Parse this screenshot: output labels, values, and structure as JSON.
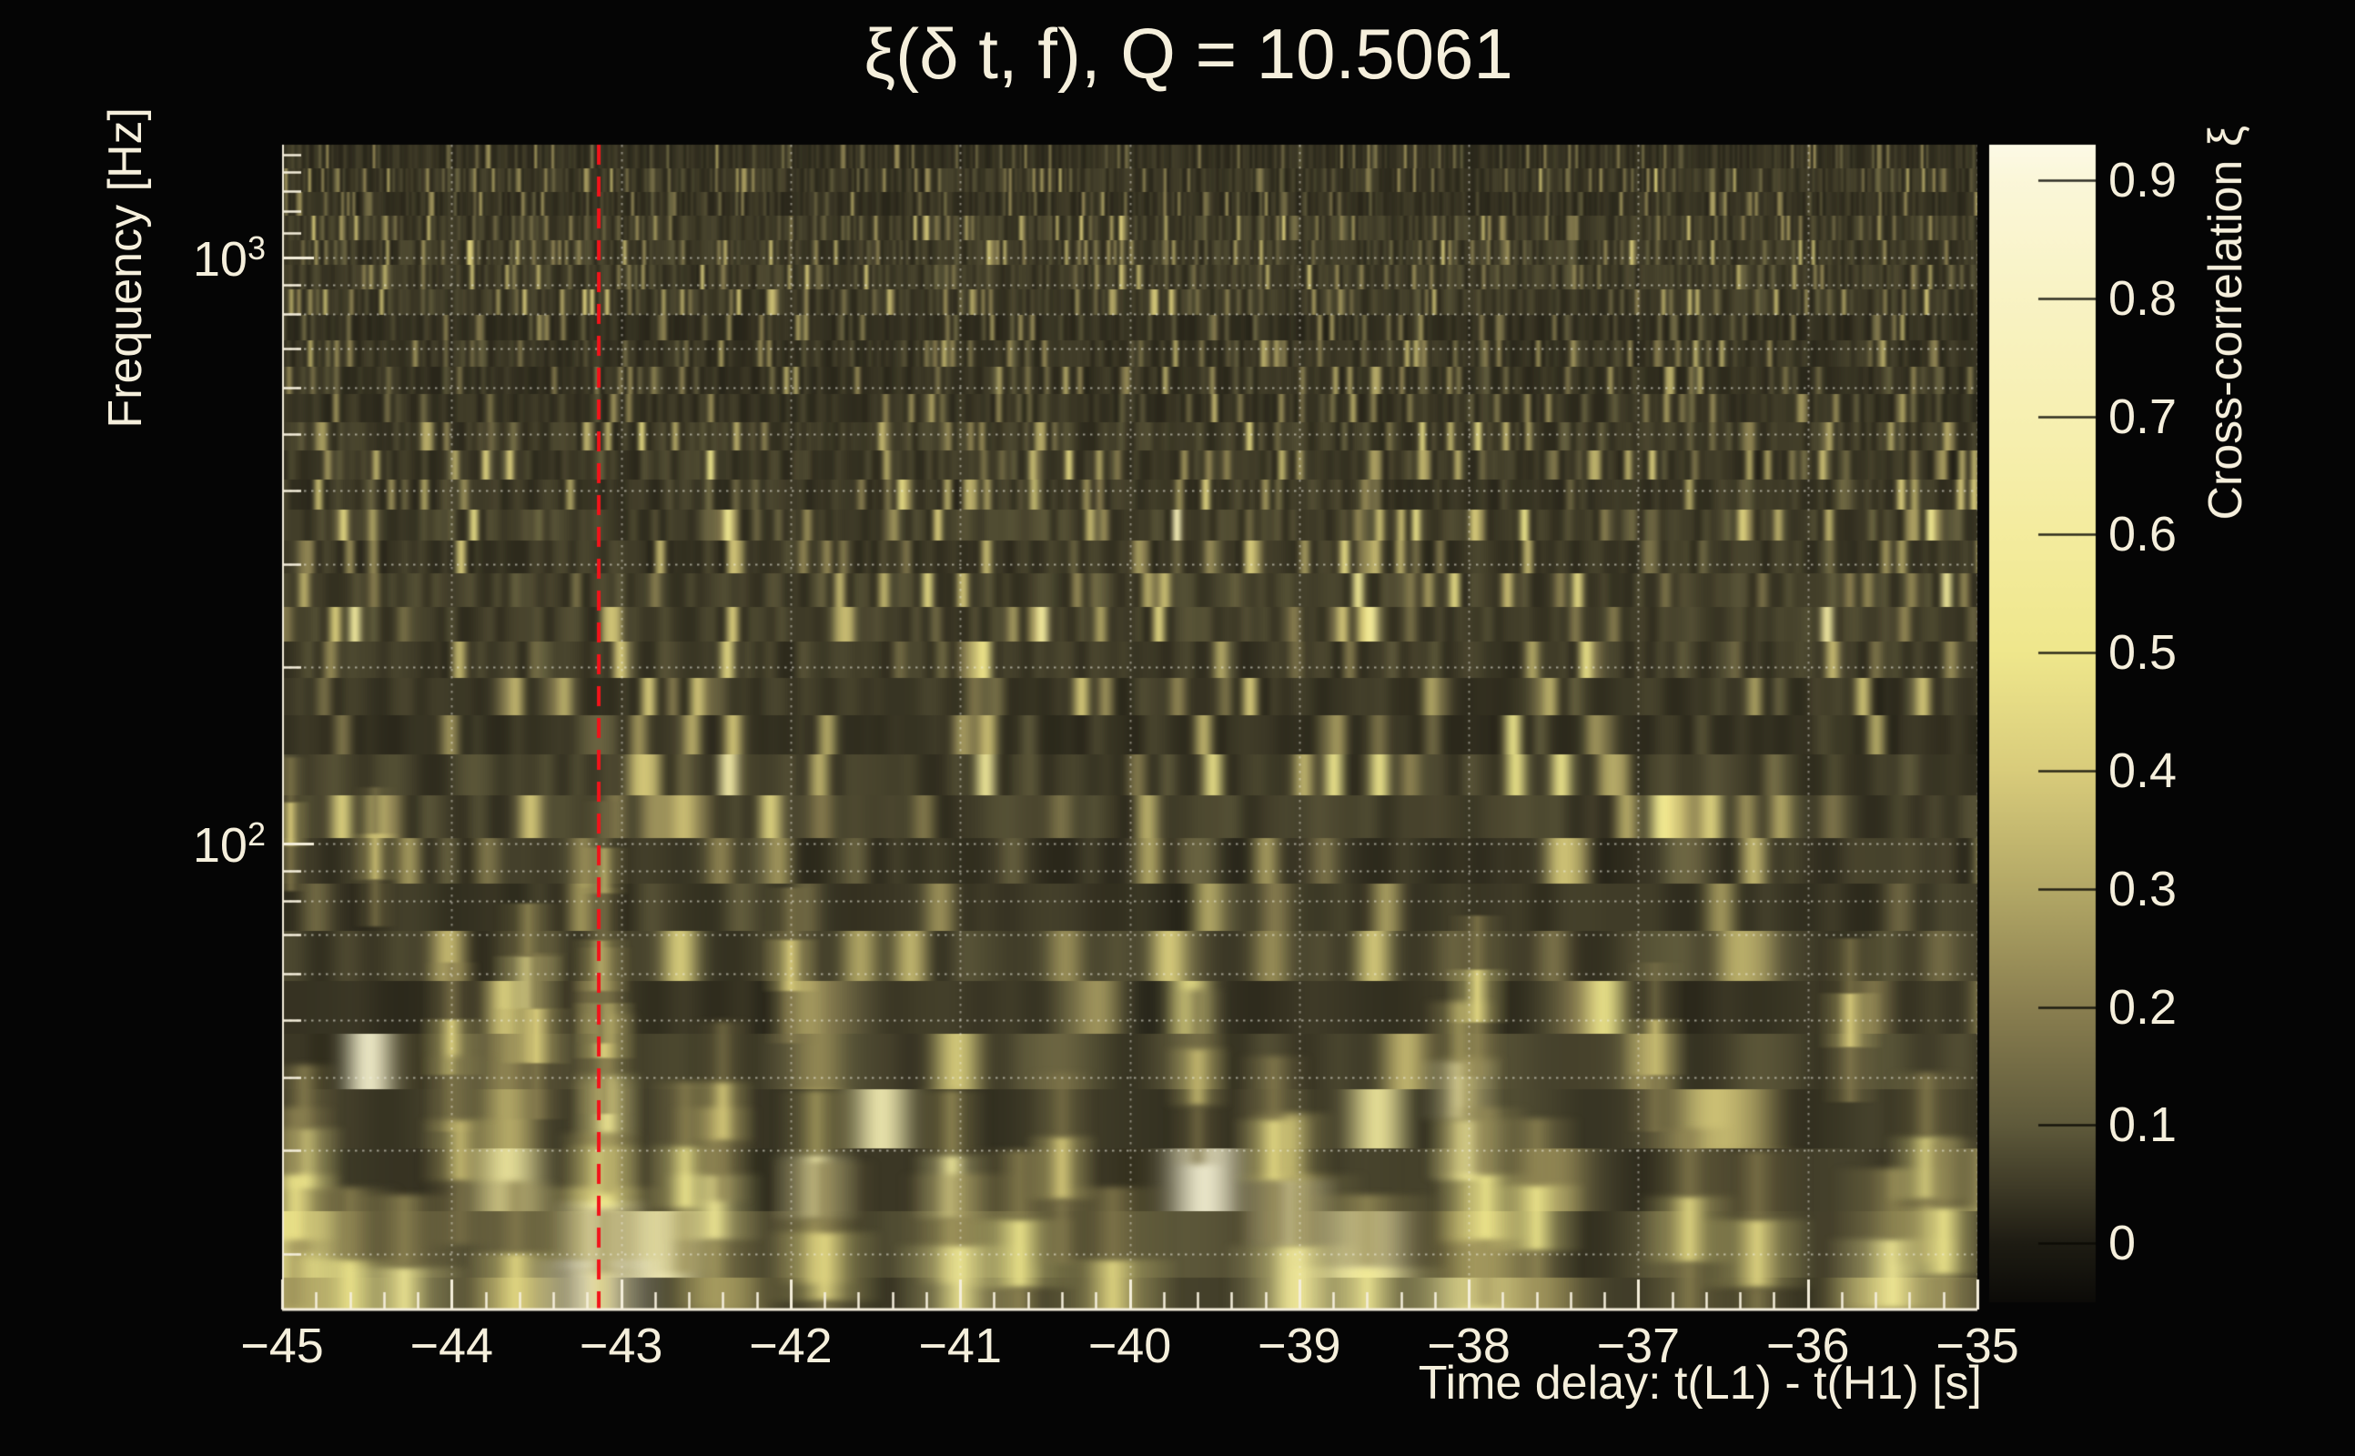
{
  "page": {
    "background_color": "#050505",
    "text_color": "#f5efdc"
  },
  "chart_data": {
    "type": "heatmap",
    "title": "ξ(δ t, f), Q = 10.5061",
    "xlabel": "Time delay: t(L1) - t(H1) [s]",
    "ylabel": "Frequency [Hz]",
    "zlabel": "Cross-correlation ξ",
    "x_range": [
      -45,
      -35
    ],
    "x_major_tick_values": [
      -45,
      -44,
      -43,
      -42,
      -41,
      -40,
      -39,
      -38,
      -37,
      -36,
      -35
    ],
    "x_tick_labels": [
      "−45",
      "−44",
      "−43",
      "−42",
      "−41",
      "−40",
      "−39",
      "−38",
      "−37",
      "−36",
      "−35"
    ],
    "x_minor_step": 0.2,
    "y_scale": "log",
    "y_range_hz": [
      16,
      1558
    ],
    "y_major_ticks": [
      {
        "value": 100,
        "base": "10",
        "exp": "2"
      },
      {
        "value": 1000,
        "base": "10",
        "exp": "3"
      }
    ],
    "y_gridline_frequencies": [
      20,
      30,
      40,
      50,
      60,
      70,
      80,
      90,
      100,
      200,
      300,
      400,
      500,
      600,
      700,
      800,
      900,
      1000
    ],
    "y_extra_minor_ticks": [
      1100,
      1200,
      1300,
      1400,
      1500
    ],
    "grid": {
      "style": "dotted",
      "color": "rgba(240,238,228,0.55)"
    },
    "marker_line": {
      "time_delay_s": -43.13,
      "color": "#f2131a",
      "style": "dashed"
    },
    "colorbar": {
      "value_top": 0.93,
      "value_bottom": -0.05,
      "tick_values": [
        0,
        0.1,
        0.2,
        0.3,
        0.4,
        0.5,
        0.6,
        0.7,
        0.8,
        0.9
      ],
      "tick_labels": [
        "0",
        "0.1",
        "0.2",
        "0.3",
        "0.4",
        "0.5",
        "0.6",
        "0.7",
        "0.8",
        "0.9"
      ],
      "colormap_stops": [
        {
          "v": -0.05,
          "c": "#0c0b08"
        },
        {
          "v": 0.0,
          "c": "#1e1c13"
        },
        {
          "v": 0.05,
          "c": "#403c28"
        },
        {
          "v": 0.1,
          "c": "#5f5a3b"
        },
        {
          "v": 0.2,
          "c": "#8a7f50"
        },
        {
          "v": 0.3,
          "c": "#b3a866"
        },
        {
          "v": 0.4,
          "c": "#d9cc7b"
        },
        {
          "v": 0.5,
          "c": "#efe78c"
        },
        {
          "v": 0.6,
          "c": "#f4ec9e"
        },
        {
          "v": 0.7,
          "c": "#f7f0b2"
        },
        {
          "v": 0.8,
          "c": "#f9f3c4"
        },
        {
          "v": 0.9,
          "c": "#fbf7d9"
        },
        {
          "v": 0.93,
          "c": "#fdfae6"
        }
      ]
    },
    "hotspots": [
      [
        -43.15,
        17.0,
        0.97,
        0.46
      ],
      [
        -43.12,
        21.5,
        0.8,
        0.3
      ],
      [
        -43.1,
        27.0,
        0.5,
        0.25
      ],
      [
        -43.08,
        36.0,
        0.55,
        0.22
      ],
      [
        -43.1,
        48.0,
        0.42,
        0.2
      ],
      [
        -43.12,
        62.0,
        0.3,
        0.18
      ],
      [
        -43.1,
        90.0,
        0.3,
        0.15
      ],
      [
        -43.55,
        58.0,
        0.55,
        0.22
      ],
      [
        -43.5,
        47.0,
        0.4,
        0.22
      ],
      [
        -43.62,
        17.5,
        0.45,
        0.3
      ],
      [
        -44.87,
        29.0,
        0.52,
        0.25
      ],
      [
        -44.92,
        24.0,
        0.48,
        0.28
      ],
      [
        -44.95,
        108.0,
        0.4,
        0.12
      ],
      [
        -44.6,
        17.0,
        0.5,
        0.35
      ],
      [
        -44.28,
        16.5,
        0.55,
        0.4
      ],
      [
        -44.0,
        45.0,
        0.42,
        0.2
      ],
      [
        -43.95,
        30.0,
        0.35,
        0.25
      ],
      [
        -42.62,
        27.0,
        0.5,
        0.25
      ],
      [
        -42.45,
        24.0,
        0.55,
        0.3
      ],
      [
        -42.4,
        35.0,
        0.4,
        0.2
      ],
      [
        -41.85,
        26.0,
        0.68,
        0.28
      ],
      [
        -41.8,
        19.0,
        0.45,
        0.35
      ],
      [
        -41.05,
        26.0,
        0.6,
        0.25
      ],
      [
        -41.0,
        18.0,
        0.55,
        0.4
      ],
      [
        -40.65,
        20.0,
        0.5,
        0.35
      ],
      [
        -40.1,
        17.0,
        0.45,
        0.4
      ],
      [
        -39.05,
        23.5,
        0.88,
        0.3
      ],
      [
        -39.0,
        18.0,
        0.6,
        0.45
      ],
      [
        -39.15,
        30.0,
        0.45,
        0.25
      ],
      [
        -38.6,
        16.5,
        0.55,
        0.5
      ],
      [
        -38.05,
        38.0,
        0.7,
        0.25
      ],
      [
        -38.0,
        30.0,
        0.6,
        0.25
      ],
      [
        -37.95,
        55.0,
        0.45,
        0.2
      ],
      [
        -37.9,
        24.0,
        0.5,
        0.3
      ],
      [
        -37.6,
        23.0,
        0.5,
        0.3
      ],
      [
        -36.7,
        22.0,
        0.45,
        0.3
      ],
      [
        -36.3,
        20.0,
        0.45,
        0.35
      ],
      [
        -35.5,
        18.5,
        0.55,
        0.4
      ],
      [
        -35.3,
        28.0,
        0.5,
        0.25
      ],
      [
        -35.2,
        21.0,
        0.5,
        0.3
      ],
      [
        -44.45,
        95.0,
        0.35,
        0.15
      ],
      [
        -42.0,
        62.0,
        0.4,
        0.18
      ],
      [
        -40.4,
        28.0,
        0.4,
        0.22
      ],
      [
        -39.6,
        40.0,
        0.35,
        0.2
      ],
      [
        -36.9,
        45.0,
        0.35,
        0.2
      ],
      [
        -35.75,
        50.0,
        0.4,
        0.2
      ]
    ],
    "noise_texture": {
      "seed": 20,
      "spike_threshold": 0.8,
      "spike_amp_top": 0.28,
      "spike_amp_bottom_extra": 0.42,
      "floor_min": 0.02,
      "floor_rand": 0.05
    }
  }
}
